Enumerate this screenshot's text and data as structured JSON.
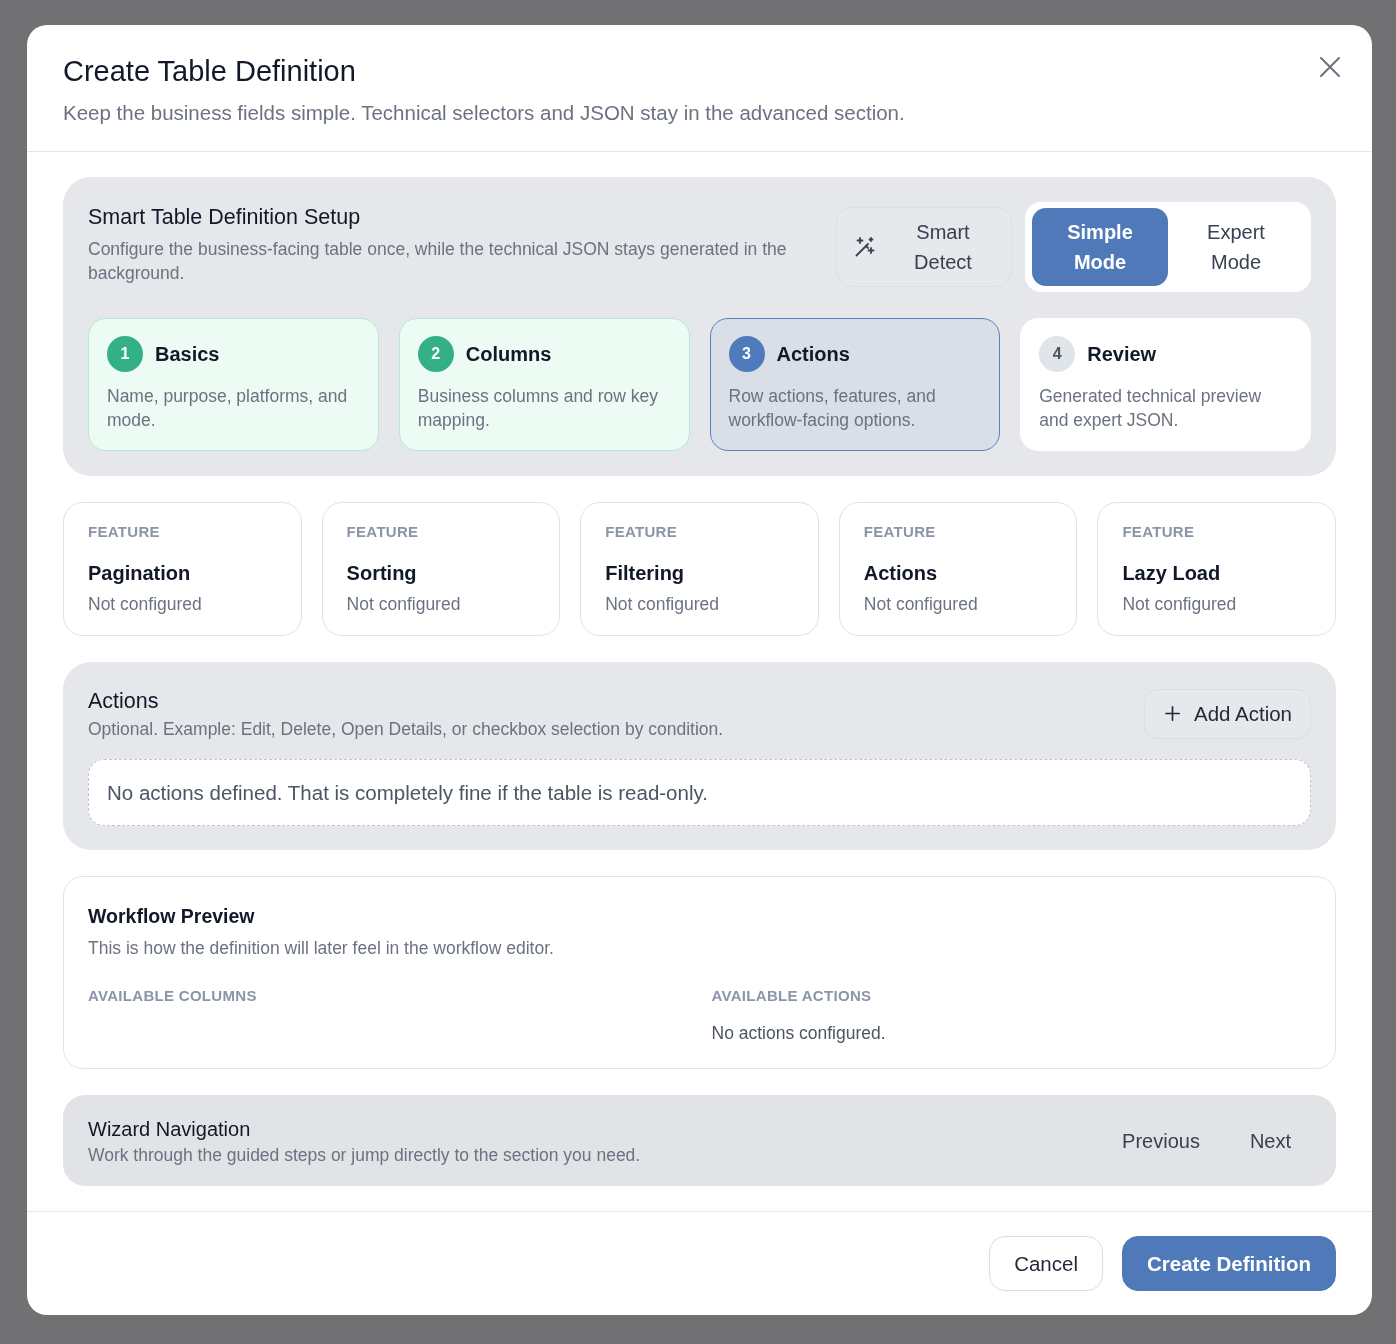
{
  "dialog": {
    "title": "Create Table Definition",
    "subtitle": "Keep the business fields simple. Technical selectors and JSON stay in the advanced section."
  },
  "setup": {
    "title": "Smart Table Definition Setup",
    "description": "Configure the business-facing table once, while the technical JSON stays generated in the background.",
    "smart_detect": "Smart Detect",
    "modes": [
      {
        "label": "Simple Mode",
        "selected": true
      },
      {
        "label": "Expert Mode",
        "selected": false
      }
    ],
    "steps": [
      {
        "number": "1",
        "title": "Basics",
        "description": "Name, purpose, platforms, and mode.",
        "completed": true,
        "selected": false
      },
      {
        "number": "2",
        "title": "Columns",
        "description": "Business columns and row key mapping.",
        "completed": true,
        "selected": false
      },
      {
        "number": "3",
        "title": "Actions",
        "description": "Row actions, features, and workflow-facing options.",
        "completed": false,
        "selected": true
      },
      {
        "number": "4",
        "title": "Review",
        "description": "Generated technical preview and expert JSON.",
        "completed": false,
        "selected": false
      }
    ]
  },
  "features": [
    {
      "label": "FEATURE",
      "name": "Pagination",
      "value": "Not configured"
    },
    {
      "label": "FEATURE",
      "name": "Sorting",
      "value": "Not configured"
    },
    {
      "label": "FEATURE",
      "name": "Filtering",
      "value": "Not configured"
    },
    {
      "label": "FEATURE",
      "name": "Actions",
      "value": "Not configured"
    },
    {
      "label": "FEATURE",
      "name": "Lazy Load",
      "value": "Not configured"
    }
  ],
  "actions": {
    "title": "Actions",
    "description": "Optional. Example: Edit, Delete, Open Details, or checkbox selection by condition.",
    "add_button": "Add Action",
    "empty_message": "No actions defined. That is completely fine if the table is read-only."
  },
  "workflow_preview": {
    "title": "Workflow Preview",
    "description": "This is how the definition will later feel in the workflow editor.",
    "columns": [
      {
        "heading": "AVAILABLE COLUMNS"
      },
      {
        "heading": "AVAILABLE ACTIONS",
        "message": "No actions configured."
      }
    ]
  },
  "wizard_navigation": {
    "title": "Wizard Navigation",
    "description": "Work through the guided steps or jump directly to the section you need.",
    "buttons": [
      "Previous",
      "Next"
    ]
  },
  "footer": {
    "buttons": [
      {
        "label": "Cancel",
        "kind": "secondary"
      },
      {
        "label": "Create Definition",
        "kind": "primary"
      }
    ]
  }
}
